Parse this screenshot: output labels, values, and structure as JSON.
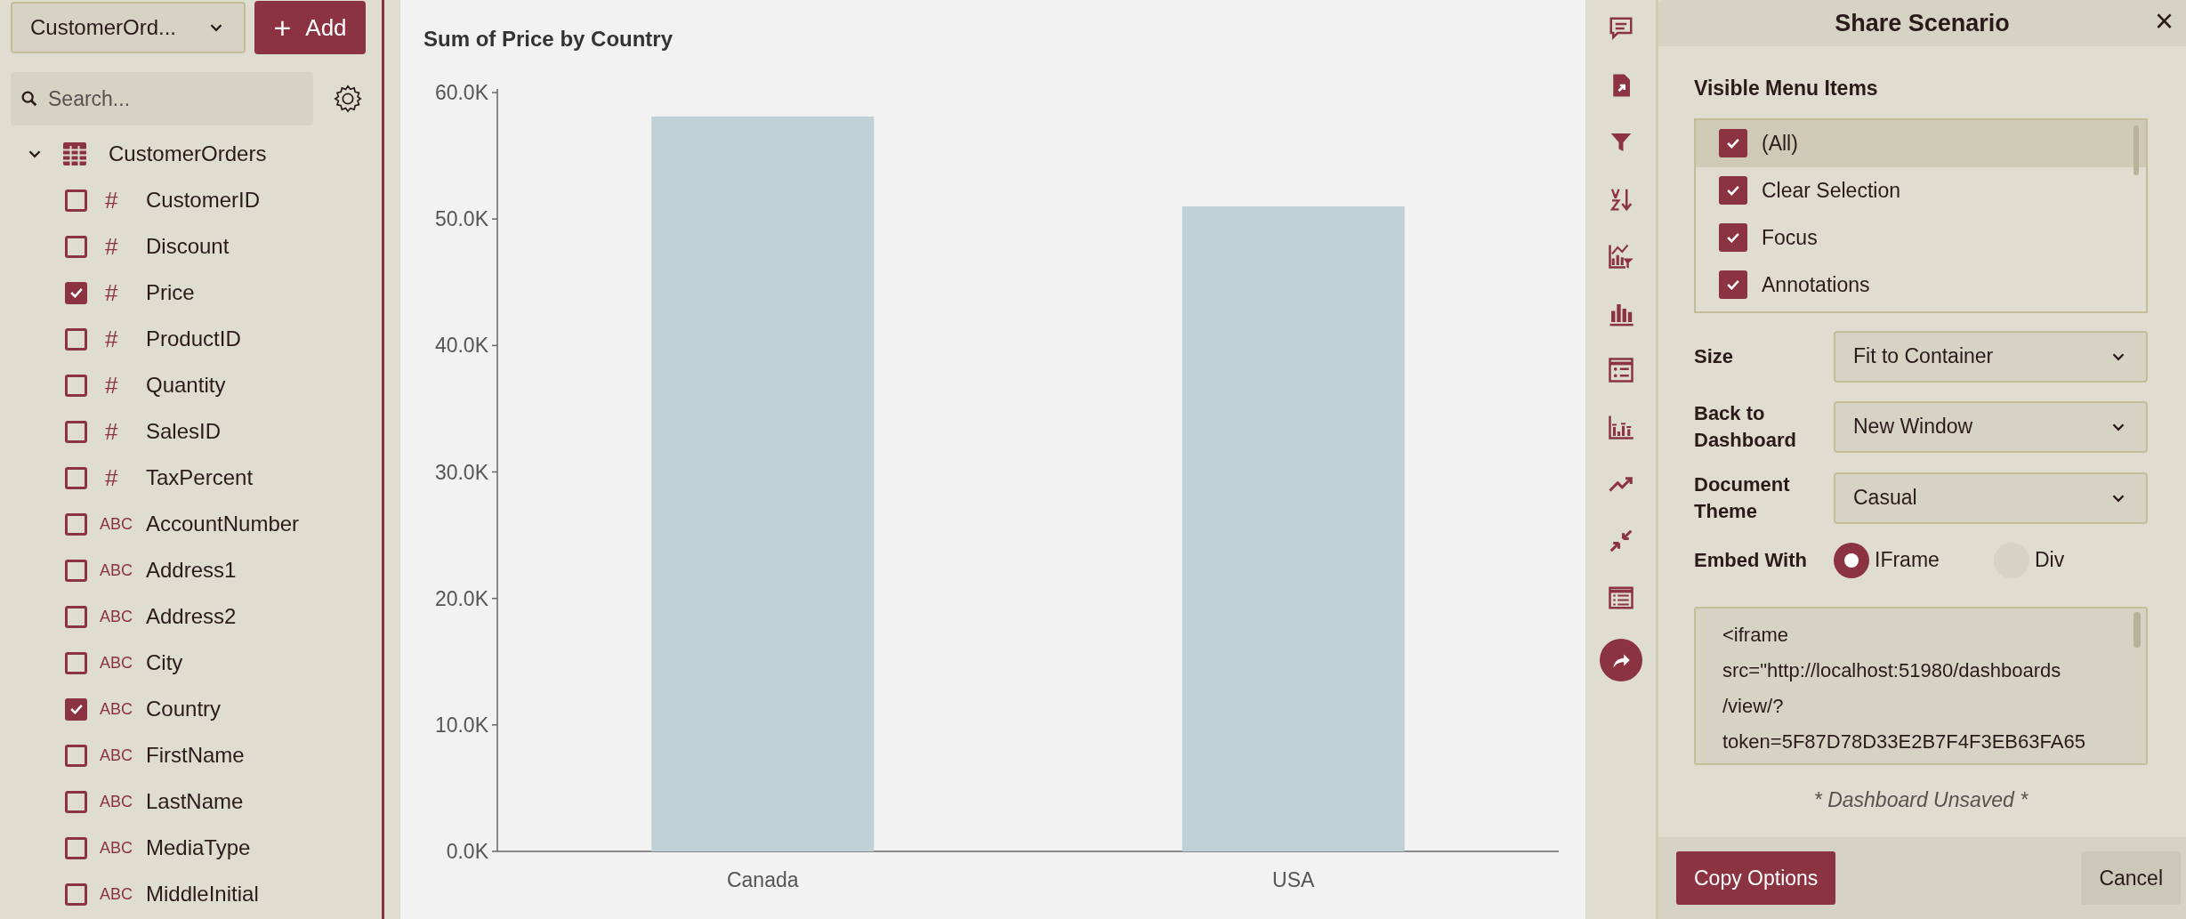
{
  "source_select": {
    "value": "CustomerOrd..."
  },
  "add_button": {
    "label": "Add",
    "icon": "+"
  },
  "search": {
    "placeholder": "Search..."
  },
  "tree": {
    "label": "CustomerOrders",
    "expanded": true,
    "children": [
      {
        "kind": "number",
        "type_label": "#",
        "label": "CustomerID",
        "checked": false
      },
      {
        "kind": "number",
        "type_label": "#",
        "label": "Discount",
        "checked": false
      },
      {
        "kind": "number",
        "type_label": "#",
        "label": "Price",
        "checked": true
      },
      {
        "kind": "number",
        "type_label": "#",
        "label": "ProductID",
        "checked": false
      },
      {
        "kind": "number",
        "type_label": "#",
        "label": "Quantity",
        "checked": false
      },
      {
        "kind": "number",
        "type_label": "#",
        "label": "SalesID",
        "checked": false
      },
      {
        "kind": "number",
        "type_label": "#",
        "label": "TaxPercent",
        "checked": false
      },
      {
        "kind": "text",
        "type_label": "ABC",
        "label": "AccountNumber",
        "checked": false
      },
      {
        "kind": "text",
        "type_label": "ABC",
        "label": "Address1",
        "checked": false
      },
      {
        "kind": "text",
        "type_label": "ABC",
        "label": "Address2",
        "checked": false
      },
      {
        "kind": "text",
        "type_label": "ABC",
        "label": "City",
        "checked": false
      },
      {
        "kind": "text",
        "type_label": "ABC",
        "label": "Country",
        "checked": true
      },
      {
        "kind": "text",
        "type_label": "ABC",
        "label": "FirstName",
        "checked": false
      },
      {
        "kind": "text",
        "type_label": "ABC",
        "label": "LastName",
        "checked": false
      },
      {
        "kind": "text",
        "type_label": "ABC",
        "label": "MediaType",
        "checked": false
      },
      {
        "kind": "text",
        "type_label": "ABC",
        "label": "MiddleInitial",
        "checked": false
      }
    ]
  },
  "chart": {
    "chart_data": {
      "type": "bar",
      "title": "Sum of Price by Country",
      "categories": [
        "Canada",
        "USA"
      ],
      "series": [
        {
          "color": "#bdd1d6",
          "values": [
            58100,
            51000
          ]
        }
      ],
      "ylim": [
        0,
        60000
      ],
      "yticks": [
        {
          "value": 0,
          "label": "0.0K"
        },
        {
          "value": 10000,
          "label": "10.0K"
        },
        {
          "value": 20000,
          "label": "20.0K"
        },
        {
          "value": 30000,
          "label": "30.0K"
        },
        {
          "value": 40000,
          "label": "40.0K"
        },
        {
          "value": 50000,
          "label": "50.0K"
        },
        {
          "value": 60000,
          "label": "60.0K"
        }
      ]
    }
  },
  "toolbar": [
    {
      "selected": false
    },
    {
      "selected": false
    },
    {
      "selected": false
    },
    {
      "selected": false
    },
    {
      "selected": false
    },
    {
      "selected": false
    },
    {
      "selected": false
    },
    {
      "selected": false
    },
    {
      "selected": false
    },
    {
      "selected": false
    },
    {
      "selected": false
    },
    {
      "selected": true
    }
  ],
  "share_panel": {
    "title": "Share Scenario",
    "close": "×",
    "menu_items_label": "Visible Menu Items",
    "menu_items": [
      {
        "label": "(All)",
        "checked": true,
        "selected": true
      },
      {
        "label": "Clear Selection",
        "checked": true,
        "selected": false
      },
      {
        "label": "Focus",
        "checked": true,
        "selected": false
      },
      {
        "label": "Annotations",
        "checked": true,
        "selected": false
      }
    ],
    "selects": [
      {
        "label": "Size",
        "value": "Fit to Container"
      },
      {
        "label": "Back to Dashboard",
        "value": "New Window"
      },
      {
        "label": "Document Theme",
        "value": "Casual"
      }
    ],
    "embed_label": "Embed With",
    "embed_options": [
      {
        "label": "IFrame",
        "selected": true
      },
      {
        "label": "Div",
        "selected": false
      }
    ],
    "embed_code_lines": [
      "<iframe",
      "src=\"http://localhost:51980/dashboards",
      "/view/?",
      "token=5F87D78D33E2B7F4F3EB63FA65"
    ],
    "status": "* Dashboard Unsaved *",
    "copy_button": "Copy Options",
    "cancel_button": "Cancel"
  }
}
